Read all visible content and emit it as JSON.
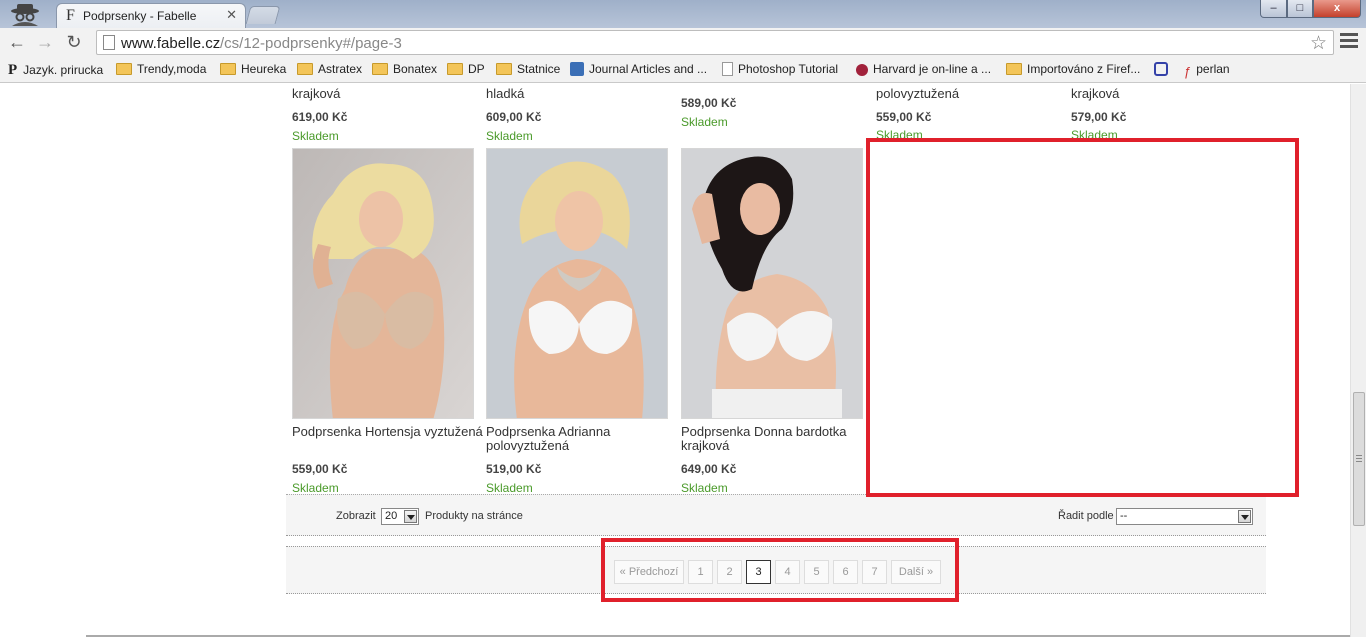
{
  "browser": {
    "tab_title": "Podprsenky - Fabelle",
    "tab_favicon": "F",
    "url_host": "www.fabelle.cz",
    "url_path": "/cs/12-podprsenky#/page-3",
    "window_controls": {
      "minimize": "–",
      "maximize": "□",
      "close": "x"
    }
  },
  "bookmarks": [
    {
      "label": "Jazyk. prirucka",
      "icon": "P"
    },
    {
      "label": "Trendy,moda",
      "icon": "folder-icon"
    },
    {
      "label": "Heureka",
      "icon": "folder-icon"
    },
    {
      "label": "Astratex",
      "icon": "folder-icon"
    },
    {
      "label": "Bonatex",
      "icon": "folder-icon"
    },
    {
      "label": "DP",
      "icon": "folder-icon"
    },
    {
      "label": "Statnice",
      "icon": "folder-icon"
    },
    {
      "label": "Journal Articles and ...",
      "icon": "journal-icon"
    },
    {
      "label": "Photoshop Tutorial",
      "icon": "page-icon"
    },
    {
      "label": "Harvard je on-line a ...",
      "icon": "pin-icon"
    },
    {
      "label": "Importováno z Firef...",
      "icon": "folder-icon"
    },
    {
      "label": "",
      "icon": "lg-icon"
    },
    {
      "label": "perlan",
      "icon": "perlan-icon"
    }
  ],
  "products_top_row": [
    {
      "name_tail": "krajková",
      "price": "619,00 Kč",
      "stock": "Skladem"
    },
    {
      "name_tail": "hladká",
      "price": "609,00 Kč",
      "stock": "Skladem"
    },
    {
      "name_tail": "",
      "price": "589,00 Kč",
      "stock": "Skladem"
    },
    {
      "name_tail": "polovyztužená",
      "price": "559,00 Kč",
      "stock": "Skladem"
    },
    {
      "name_tail": "krajková",
      "price": "579,00 Kč",
      "stock": "Skladem"
    }
  ],
  "products": [
    {
      "name": "Podprsenka Hortensja vyztužená",
      "price": "559,00 Kč",
      "stock": "Skladem"
    },
    {
      "name": "Podprsenka Adrianna polovyztužená",
      "price": "519,00 Kč",
      "stock": "Skladem"
    },
    {
      "name": "Podprsenka Donna bardotka krajková",
      "price": "649,00 Kč",
      "stock": "Skladem"
    }
  ],
  "listing": {
    "show_label": "Zobrazit",
    "per_page_value": "20",
    "per_page_suffix": "Produkty na stránce",
    "sort_label": "Řadit podle",
    "sort_value": "--"
  },
  "pagination": {
    "prev": "« Předchozí",
    "pages": [
      "1",
      "2",
      "3",
      "4",
      "5",
      "6",
      "7"
    ],
    "current": "3",
    "next": "Další »"
  },
  "colors": {
    "stock_green": "#4a9a2a",
    "annotation_red": "#e0202b"
  }
}
